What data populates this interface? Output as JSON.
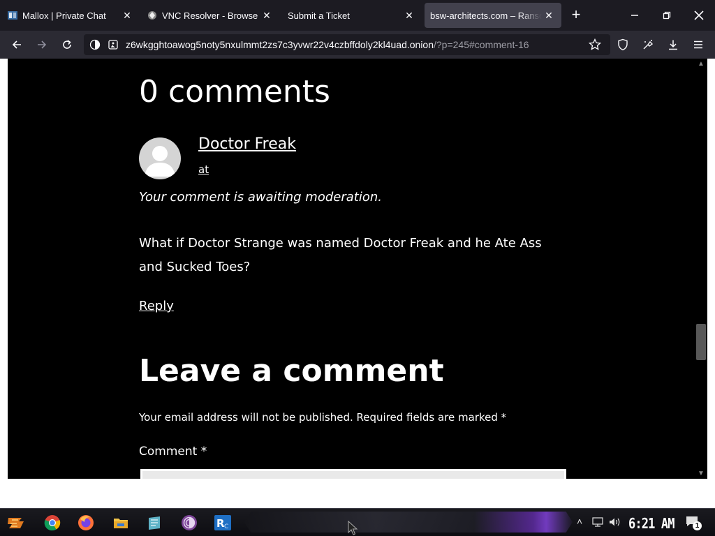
{
  "browser": {
    "tabs": [
      {
        "title": "Mallox | Private Chat",
        "icon": "mallox-favicon-icon",
        "active": false
      },
      {
        "title": "VNC Resolver - Browse",
        "icon": "vnc-favicon-icon",
        "active": false
      },
      {
        "title": "Submit a Ticket",
        "icon": "",
        "active": false
      },
      {
        "title": "bsw-architects.com – Ransom",
        "icon": "",
        "active": true
      }
    ],
    "url_host": "z6wkgghtoawog5noty5nxulmmt2zs7c3yvwr22v4czbffdoly2kl4uad.onion",
    "url_rest": "/?p=245#comment-16"
  },
  "page": {
    "comments_heading": "0 comments",
    "comment": {
      "author": "Doctor Freak",
      "date_link": "at",
      "status": "Your comment is awaiting moderation.",
      "body": "What if Doctor Strange was named Doctor Freak and he Ate Ass and Sucked Toes?",
      "reply_label": "Reply"
    },
    "leave_comment_heading": "Leave a comment",
    "notes": "Your email address will not be published. Required fields are marked *",
    "comment_label": "Comment *",
    "comment_value": ""
  },
  "taskbar": {
    "clock": "6:21 AM",
    "notification_count": "1",
    "apps": [
      "start-icon",
      "chrome-icon",
      "firefox-icon",
      "file-explorer-icon",
      "app-icon",
      "tor-browser-icon",
      "remote-desktop-icon"
    ]
  },
  "colors": {
    "page_bg": "#000000",
    "tab_bar": "#1c1b22",
    "nav_bar": "#2b2a33",
    "active_tab": "#42414d"
  }
}
